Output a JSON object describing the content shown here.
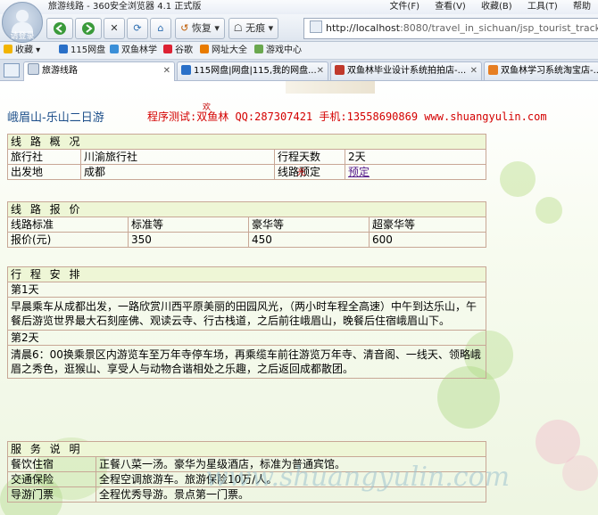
{
  "window": {
    "title": "旅游线路 - 360安全浏览器 4.1 正式版",
    "menus": [
      "文件(F)",
      "查看(V)",
      "收藏(B)",
      "工具(T)",
      "帮助"
    ]
  },
  "avatar_label": "请登录",
  "toolbar": {
    "restore_label": "恢复",
    "noscent_label": "无痕",
    "url_host": "http://localhost",
    "url_rest": ":8080/travel_in_sichuan/jsp_tourist_track/xianludetail"
  },
  "favorites": {
    "collect_label": "收藏",
    "items": [
      "115网盘",
      "双鱼林学",
      "谷歌",
      "网址大全",
      "游戏中心"
    ]
  },
  "tabs": [
    {
      "label": "旅游线路"
    },
    {
      "label": "115网盘|网盘|115,我的网盘..."
    },
    {
      "label": "双鱼林毕业设计系统拍拍店-..."
    },
    {
      "label": "双鱼林学习系统淘宝店-..."
    }
  ],
  "page": {
    "heading": "峨眉山-乐山二日游",
    "credit": "程序测试:双鱼林 QQ:287307421 手机:13558690869 www.shuangyulin.com",
    "tiny_1": "欢",
    "tiny_2": "迎",
    "tiny_3": "光",
    "tiny_4": "临",
    "overview": {
      "title": "线 路 概 况",
      "agency_label": "旅行社",
      "agency_value": "川渝旅行社",
      "days_label": "行程天数",
      "days_value": "2天",
      "depart_label": "出发地",
      "depart_value": "成都",
      "book_label": "线路预定",
      "book_link": "预定"
    },
    "pricing": {
      "title": "线 路 报 价",
      "headers": [
        "线路标准",
        "标准等",
        "豪华等",
        "超豪华等"
      ],
      "row_label": "报价(元)",
      "values": [
        "350",
        "450",
        "600"
      ]
    },
    "itinerary": {
      "title": "行 程 安 排",
      "day1_label": "第1天",
      "day1_text": "早晨乘车从成都出发，一路欣赏川西平原美丽的田园风光，（两小时车程全高速）中午到达乐山，午餐后游览世界最大石刻座佛、观读云寺、行古栈道，之后前往峨眉山，晚餐后住宿峨眉山下。",
      "day2_label": "第2天",
      "day2_text": "清晨6：00换乘景区内游览车至万年寺停车场，再乘缆车前往游览万年寺、清音阁、一线天、领略峨眉之秀色，逛猴山、享受人与动物合谐相处之乐趣，之后返回成都散团。"
    },
    "service": {
      "title": "服 务 说 明",
      "rows": [
        {
          "label": "餐饮住宿",
          "value": "正餐八菜一汤。豪华为星级酒店，标准为普通宾馆。"
        },
        {
          "label": "交通保险",
          "value": "全程空调旅游车。旅游保险10万/人。"
        },
        {
          "label": "导游门票",
          "value": "全程优秀导游。景点第一门票。"
        }
      ]
    },
    "watermark": "www.shuangyulin.com"
  }
}
